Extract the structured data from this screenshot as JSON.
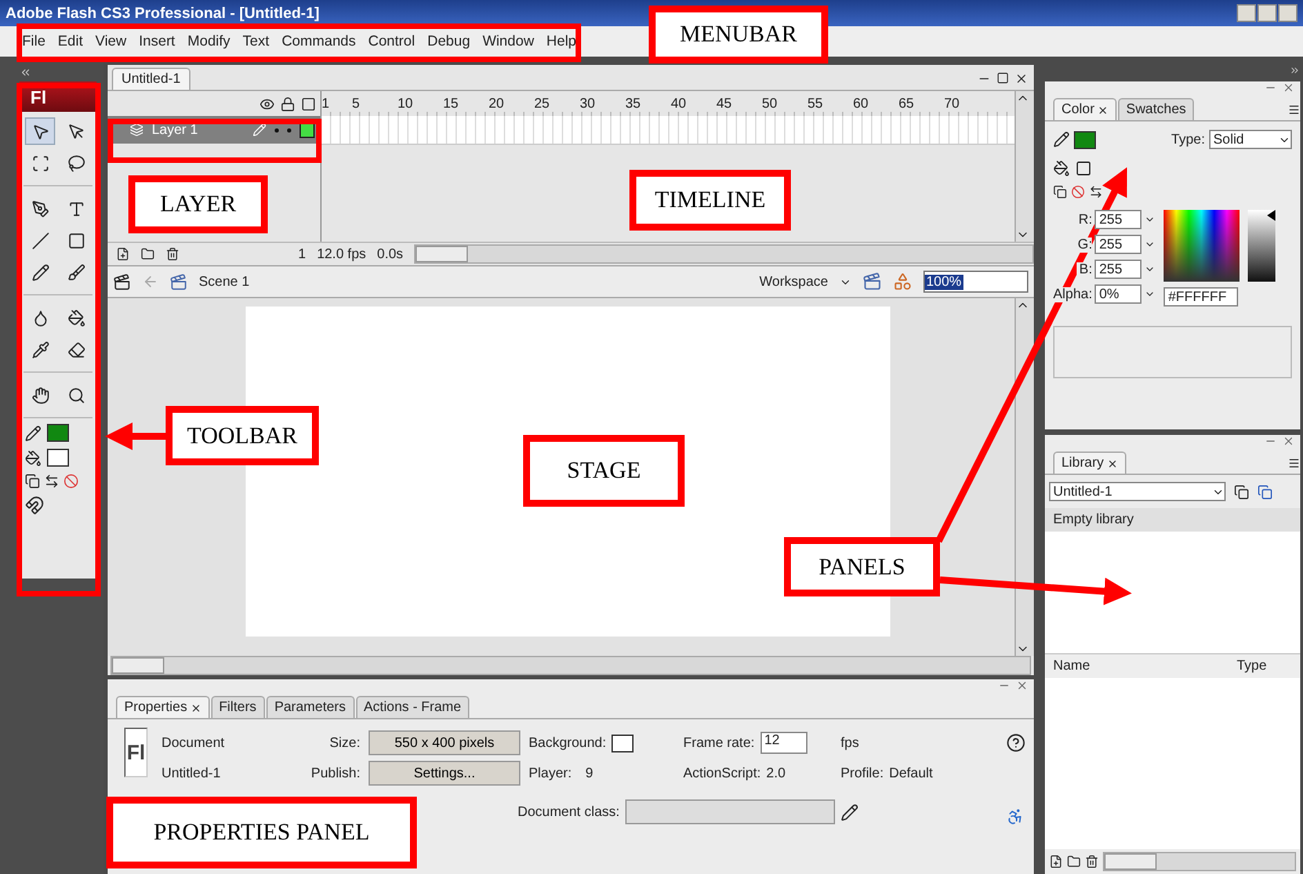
{
  "window": {
    "title": "Adobe Flash CS3 Professional - [Untitled-1]"
  },
  "menubar": [
    "File",
    "Edit",
    "View",
    "Insert",
    "Modify",
    "Text",
    "Commands",
    "Control",
    "Debug",
    "Window",
    "Help"
  ],
  "toolbar": {
    "logo": "Fl"
  },
  "document_tab": {
    "label": "Untitled-1"
  },
  "timeline": {
    "ruler": [
      "1",
      "5",
      "10",
      "15",
      "20",
      "25",
      "30",
      "35",
      "40",
      "45",
      "50",
      "55",
      "60",
      "65",
      "70"
    ],
    "layers": [
      {
        "name": "Layer 1",
        "selected": true,
        "color": "#44dd44"
      }
    ],
    "status": [
      "1",
      "12.0 fps",
      "0.0s"
    ]
  },
  "edit_bar": {
    "scene": "Scene 1",
    "workspace": "Workspace",
    "zoom": "100%"
  },
  "color_panel": {
    "tabs": [
      {
        "label": "Color",
        "selected": true
      },
      {
        "label": "Swatches",
        "selected": false
      }
    ],
    "type_label": "Type:",
    "type_value": "Solid",
    "channels": [
      {
        "label": "R:",
        "value": "255"
      },
      {
        "label": "G:",
        "value": "255"
      },
      {
        "label": "B:",
        "value": "255"
      },
      {
        "label": "Alpha:",
        "value": "0%"
      }
    ],
    "hex": "#FFFFFF",
    "brightness": {
      "level": 1
    }
  },
  "library_panel": {
    "tabs": [
      {
        "label": "Library",
        "selected": true
      }
    ],
    "document": "Untitled-1",
    "status": "Empty library",
    "columns": [
      "Name",
      "Type"
    ]
  },
  "properties_panel": {
    "tabs": [
      {
        "label": "Properties",
        "selected": true
      },
      {
        "label": "Filters",
        "selected": false
      },
      {
        "label": "Parameters",
        "selected": false
      },
      {
        "label": "Actions - Frame",
        "selected": false
      }
    ],
    "logo": "Fl",
    "kind_label": "Document",
    "doc_name": "Untitled-1",
    "size_label": "Size:",
    "size_button": "550 x 400 pixels",
    "publish_label": "Publish:",
    "publish_button": "Settings...",
    "background_label": "Background:",
    "frame_rate_label": "Frame rate:",
    "frame_rate": "12",
    "fps_label": "fps",
    "player_label": "Player:",
    "player": "9",
    "actionscript_label": "ActionScript:",
    "actionscript": "2.0",
    "profile_label": "Profile:",
    "profile": "Default",
    "document_class_label": "Document class:"
  },
  "annotations": [
    {
      "text": "MENUBAR"
    },
    {
      "text": "LAYER"
    },
    {
      "text": "TIMELINE"
    },
    {
      "text": "TOOLBAR"
    },
    {
      "text": "STAGE"
    },
    {
      "text": "PANELS"
    },
    {
      "text": "PROPERTIES PANEL"
    }
  ]
}
